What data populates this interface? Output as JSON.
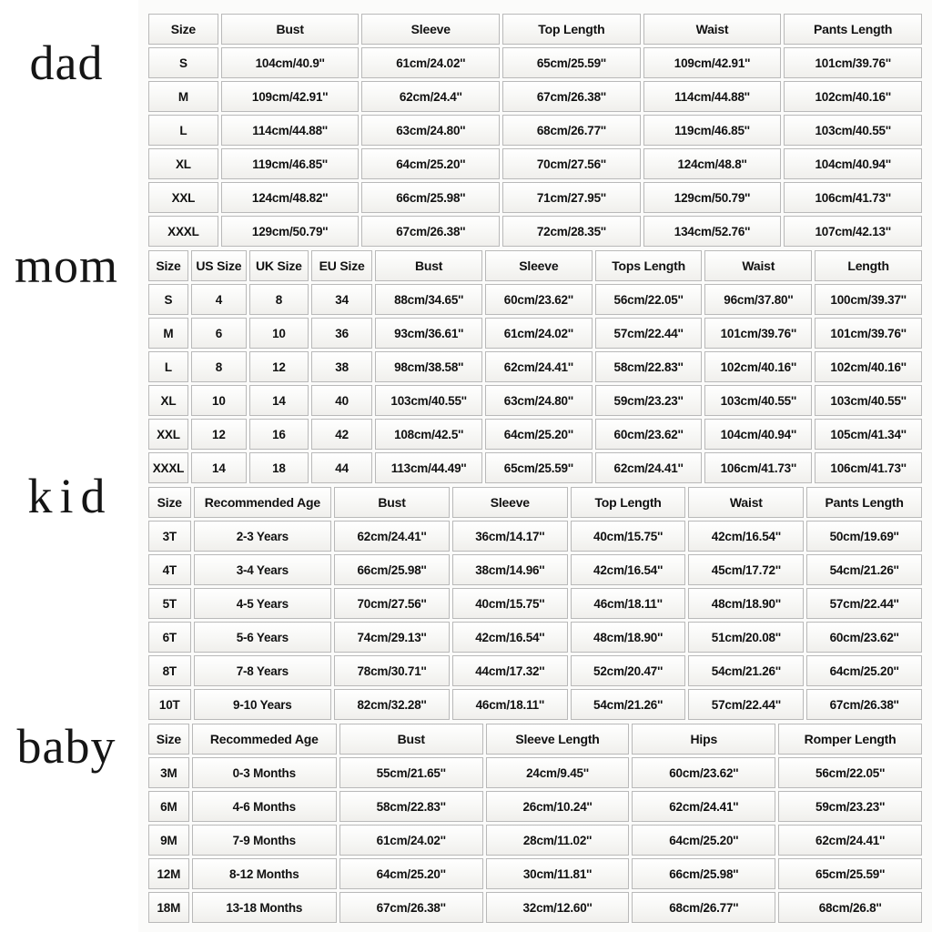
{
  "page": {
    "background_color": "#ffffff",
    "panel_color": "#fbfbfa",
    "text_color": "#111111",
    "border_color": "#b9b9b9"
  },
  "groups": [
    {
      "label": "dad",
      "name": "dad",
      "columns": [
        "Size",
        "Bust",
        "Sleeve",
        "Top Length",
        "Waist",
        "Pants Length"
      ],
      "rows": [
        [
          "S",
          "104cm/40.9''",
          "61cm/24.02''",
          "65cm/25.59''",
          "109cm/42.91''",
          "101cm/39.76''"
        ],
        [
          "M",
          "109cm/42.91''",
          "62cm/24.4''",
          "67cm/26.38''",
          "114cm/44.88''",
          "102cm/40.16''"
        ],
        [
          "L",
          "114cm/44.88''",
          "63cm/24.80''",
          "68cm/26.77''",
          "119cm/46.85''",
          "103cm/40.55''"
        ],
        [
          "XL",
          "119cm/46.85''",
          "64cm/25.20''",
          "70cm/27.56''",
          "124cm/48.8''",
          "104cm/40.94''"
        ],
        [
          "XXL",
          "124cm/48.82''",
          "66cm/25.98''",
          "71cm/27.95''",
          "129cm/50.79''",
          "106cm/41.73''"
        ],
        [
          "XXXL",
          "129cm/50.79''",
          "67cm/26.38''",
          "72cm/28.35''",
          "134cm/52.76''",
          "107cm/42.13''"
        ]
      ]
    },
    {
      "label": "mom",
      "name": "mom",
      "columns": [
        "Size",
        "US Size",
        "UK Size",
        "EU Size",
        "Bust",
        "Sleeve",
        "Tops Length",
        "Waist",
        "Length"
      ],
      "rows": [
        [
          "S",
          "4",
          "8",
          "34",
          "88cm/34.65''",
          "60cm/23.62''",
          "56cm/22.05''",
          "96cm/37.80''",
          "100cm/39.37''"
        ],
        [
          "M",
          "6",
          "10",
          "36",
          "93cm/36.61''",
          "61cm/24.02''",
          "57cm/22.44''",
          "101cm/39.76''",
          "101cm/39.76''"
        ],
        [
          "L",
          "8",
          "12",
          "38",
          "98cm/38.58''",
          "62cm/24.41''",
          "58cm/22.83''",
          "102cm/40.16''",
          "102cm/40.16''"
        ],
        [
          "XL",
          "10",
          "14",
          "40",
          "103cm/40.55''",
          "63cm/24.80''",
          "59cm/23.23''",
          "103cm/40.55''",
          "103cm/40.55''"
        ],
        [
          "XXL",
          "12",
          "16",
          "42",
          "108cm/42.5''",
          "64cm/25.20''",
          "60cm/23.62''",
          "104cm/40.94''",
          "105cm/41.34''"
        ],
        [
          "XXXL",
          "14",
          "18",
          "44",
          "113cm/44.49''",
          "65cm/25.59''",
          "62cm/24.41''",
          "106cm/41.73''",
          "106cm/41.73''"
        ]
      ]
    },
    {
      "label": "kid",
      "name": "kid",
      "columns": [
        "Size",
        "Recommended Age",
        "Bust",
        "Sleeve",
        "Top Length",
        "Waist",
        "Pants Length"
      ],
      "rows": [
        [
          "3T",
          "2-3 Years",
          "62cm/24.41''",
          "36cm/14.17''",
          "40cm/15.75''",
          "42cm/16.54''",
          "50cm/19.69''"
        ],
        [
          "4T",
          "3-4 Years",
          "66cm/25.98''",
          "38cm/14.96''",
          "42cm/16.54''",
          "45cm/17.72''",
          "54cm/21.26''"
        ],
        [
          "5T",
          "4-5 Years",
          "70cm/27.56''",
          "40cm/15.75''",
          "46cm/18.11''",
          "48cm/18.90''",
          "57cm/22.44''"
        ],
        [
          "6T",
          "5-6 Years",
          "74cm/29.13''",
          "42cm/16.54''",
          "48cm/18.90''",
          "51cm/20.08''",
          "60cm/23.62''"
        ],
        [
          "8T",
          "7-8 Years",
          "78cm/30.71''",
          "44cm/17.32''",
          "52cm/20.47''",
          "54cm/21.26''",
          "64cm/25.20''"
        ],
        [
          "10T",
          "9-10 Years",
          "82cm/32.28''",
          "46cm/18.11''",
          "54cm/21.26''",
          "57cm/22.44''",
          "67cm/26.38''"
        ]
      ]
    },
    {
      "label": "baby",
      "name": "baby",
      "columns": [
        "Size",
        "Recommeded Age",
        "Bust",
        "Sleeve Length",
        "Hips",
        "Romper Length"
      ],
      "rows": [
        [
          "3M",
          "0-3 Months",
          "55cm/21.65''",
          "24cm/9.45''",
          "60cm/23.62''",
          "56cm/22.05''"
        ],
        [
          "6M",
          "4-6 Months",
          "58cm/22.83''",
          "26cm/10.24''",
          "62cm/24.41''",
          "59cm/23.23''"
        ],
        [
          "9M",
          "7-9 Months",
          "61cm/24.02''",
          "28cm/11.02''",
          "64cm/25.20''",
          "62cm/24.41''"
        ],
        [
          "12M",
          "8-12 Months",
          "64cm/25.20''",
          "30cm/11.81''",
          "66cm/25.98''",
          "65cm/25.59''"
        ],
        [
          "18M",
          "13-18 Months",
          "67cm/26.38''",
          "32cm/12.60''",
          "68cm/26.77''",
          "68cm/26.8''"
        ]
      ]
    }
  ]
}
